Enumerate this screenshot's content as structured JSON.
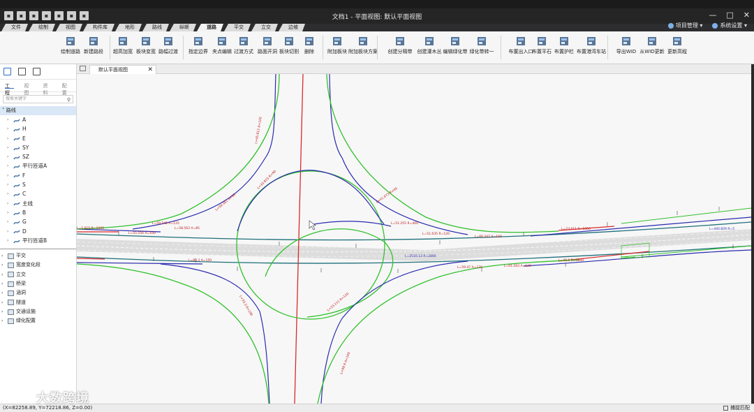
{
  "titlebar": {
    "title": "文档1 - 平面视图: 默认平面视图",
    "window_controls": [
      "—",
      "□",
      "✕"
    ]
  },
  "ribbon_tabs": [
    "文件",
    "绘制",
    "视图",
    "构件库",
    "地形",
    "路线",
    "纵断",
    "道路",
    "平交",
    "立交",
    "边坡"
  ],
  "ribbon_active_tab": "道路",
  "right_menu": {
    "project": "项目管理 ▾",
    "settings": "系统设置 ▾"
  },
  "ribbon_buttons": [
    "绘制道路",
    "新建路段",
    "超高加宽",
    "板块变宽",
    "路幅过渡",
    "指定边界",
    "夹点编辑",
    "过渡方式",
    "路面开洞",
    "板块切割",
    "删除",
    "附加板块",
    "附加板块方案",
    "创建分隔带",
    "创建灌木丛",
    "编辑绿化带",
    "绿化带转一",
    "布置出入口",
    "布置平石",
    "布置护栏",
    "布置港湾车站",
    "导出WID",
    "从WID更新",
    "更新高程"
  ],
  "left_panel": {
    "subtabs": [
      "工程",
      "视图",
      "资料",
      "配置"
    ],
    "search_placeholder": "搜索关键字",
    "tree_root": "路线",
    "routes": [
      "A",
      "H",
      "E",
      "SY",
      "SZ",
      "平行匝道A",
      "F",
      "S",
      "C",
      "主线",
      "B",
      "G",
      "D",
      "平行匝道B"
    ],
    "categories": [
      "平交",
      "宽度变化段",
      "立交",
      "桥梁",
      "涵洞",
      "隧道",
      "交通设施",
      "绿化配置"
    ]
  },
  "doc_tab": {
    "label": "默认平面视图",
    "close": "✕"
  },
  "canvas_labels": [
    "L=55.556 A=100",
    "L=59.542 A=125",
    "L=58.563 A=85",
    "L=58.361 A=80",
    "L=66.347 A=100",
    "L=51.635 R=120",
    "L=41.873 R=95",
    "L=33.815 R=90",
    "L=51.255 R=400",
    "L=45.612 A=100",
    "L=23.611 R=1000",
    "L=440.829 R=5",
    "L=2510.13 R=2800",
    "L=59.47 A=120",
    "L=61.263 A=120",
    "L=33.111 R=120",
    "L=5.615 R=1000",
    "L=48.5 R=1500",
    "L=83.3 A=150",
    "L=33.3 R=190",
    "L=98.9 A=100"
  ],
  "statusbar": {
    "coords": "(X=82258.89, Y=72218.86, Z=0.00)",
    "right": "捕捉匹配"
  },
  "watermark": "大数跨境",
  "colors": {
    "ramp_green": "#31c12c",
    "route_blue": "#2a2ab0",
    "red": "#d8292a",
    "teal": "#1f6f7a",
    "ribbon_bg": "#f6f6f6",
    "active_tree": "#d9e7f7"
  }
}
